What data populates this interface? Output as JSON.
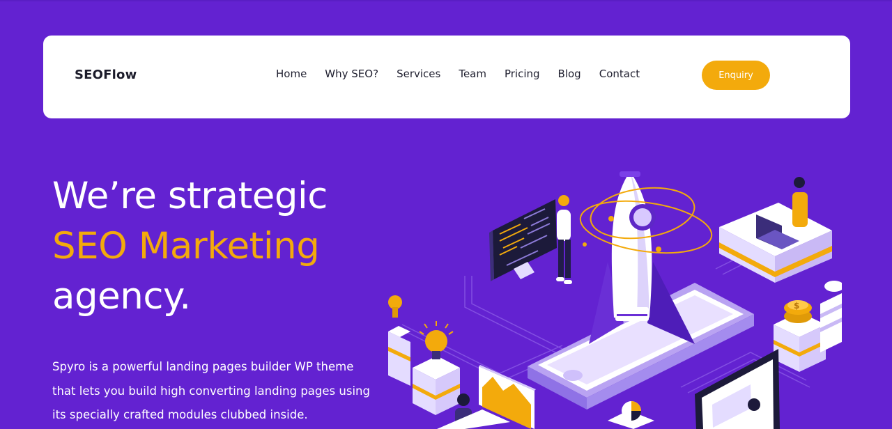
{
  "brand": {
    "name": "SEOFlow"
  },
  "nav": {
    "items": [
      {
        "label": "Home"
      },
      {
        "label": "Why SEO?"
      },
      {
        "label": "Services"
      },
      {
        "label": "Team"
      },
      {
        "label": "Pricing"
      },
      {
        "label": "Blog"
      },
      {
        "label": "Contact"
      }
    ],
    "cta_label": "Enquiry"
  },
  "hero": {
    "title_line1": "We’re strategic",
    "title_line2": "SEO Marketing",
    "title_line3": "agency.",
    "description": "Spyro is a powerful landing pages builder WP theme that lets you build high converting landing pages using its specially crafted modules clubbed inside."
  },
  "colors": {
    "background": "#6322d1",
    "accent": "#f3aa0c",
    "navbar_bg": "#ffffff",
    "text_light": "#ffffff",
    "text_dark": "#1e1e2e"
  },
  "illustration": {
    "icon": "seo-rocket-isometric-illustration"
  }
}
